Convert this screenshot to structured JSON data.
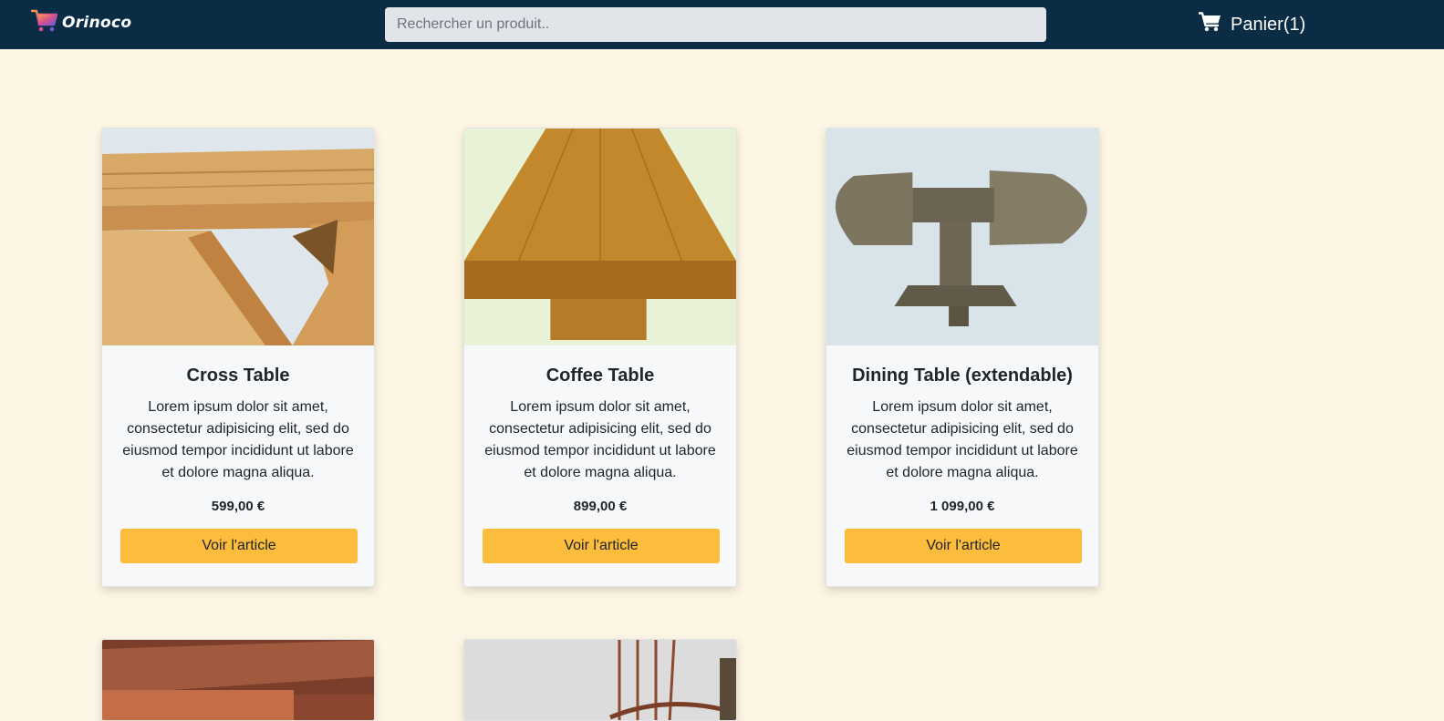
{
  "brand": {
    "name": "Orinoco"
  },
  "search": {
    "placeholder": "Rechercher un produit.."
  },
  "cart": {
    "label": "Panier(1)"
  },
  "products": [
    {
      "title": "Cross Table",
      "description": "Lorem ipsum dolor sit amet, consectetur adipisicing elit, sed do eiusmod tempor incididunt ut labore et dolore magna aliqua.",
      "price": "599,00 €",
      "button": "Voir l'article"
    },
    {
      "title": "Coffee Table",
      "description": "Lorem ipsum dolor sit amet, consectetur adipisicing elit, sed do eiusmod tempor incididunt ut labore et dolore magna aliqua.",
      "price": "899,00 €",
      "button": "Voir l'article"
    },
    {
      "title": "Dining Table (extendable)",
      "description": "Lorem ipsum dolor sit amet, consectetur adipisicing elit, sed do eiusmod tempor incididunt ut labore et dolore magna aliqua.",
      "price": "1 099,00 €",
      "button": "Voir l'article"
    }
  ],
  "colors": {
    "navbar": "#0b2c45",
    "page_background": "#fdf6e4",
    "button": "#fcbc3c",
    "search_background": "#e1e4e8"
  },
  "icons": {
    "logo": "shopping-cart-gradient-icon",
    "cart": "cart-icon"
  }
}
